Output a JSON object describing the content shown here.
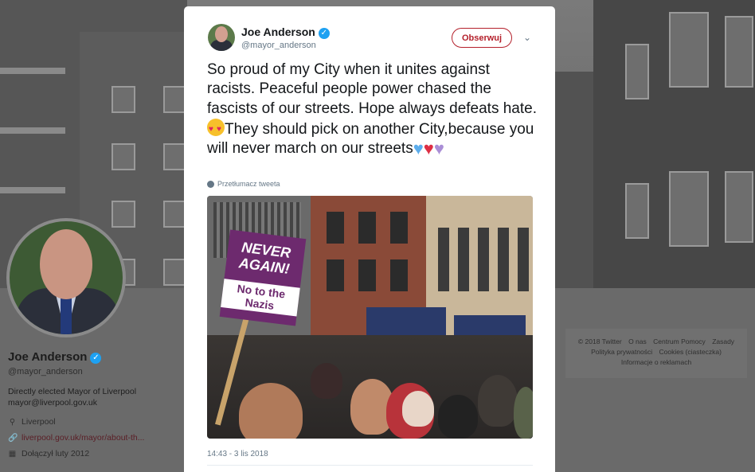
{
  "tweet": {
    "author_name": "Joe Anderson",
    "author_handle": "@mayor_anderson",
    "follow_label": "Obserwuj",
    "text_line1": "So proud of my City when it unites against racists. Peaceful people power chased the fascists of our streets. Hope always defeats hate.",
    "text_line2": "They should pick on another City,because you will never march on our streets",
    "translate_label": "Przetłumacz tweeta",
    "timestamp": "14:43 - 3 lis 2018",
    "photo_sign_line1": "NEVER AGAIN!",
    "photo_sign_line2": "No to the Nazis"
  },
  "profile": {
    "name": "Joe Anderson",
    "handle": "@mayor_anderson",
    "bio_line1": "Directly elected Mayor of Liverpool",
    "bio_line2": "mayor@liverpool.gov.uk",
    "location": "Liverpool",
    "website": "liverpool.gov.uk/mayor/about-th...",
    "joined": "Dołączył luty 2012"
  },
  "footer": {
    "copyright": "© 2018 Twitter",
    "about": "O nas",
    "help": "Centrum Pomocy",
    "terms": "Zasady",
    "privacy": "Polityka prywatności",
    "cookies": "Cookies (ciasteczka)",
    "ads": "Informacje o reklamach"
  },
  "colors": {
    "verified": "#1da1f2",
    "follow_accent": "#b4202b",
    "link": "#5a1e26"
  },
  "icons": {
    "verified": "verified-badge-icon",
    "caret": "chevron-down-icon",
    "globe": "globe-icon",
    "location": "location-pin-icon",
    "link": "link-icon",
    "calendar": "calendar-icon"
  }
}
